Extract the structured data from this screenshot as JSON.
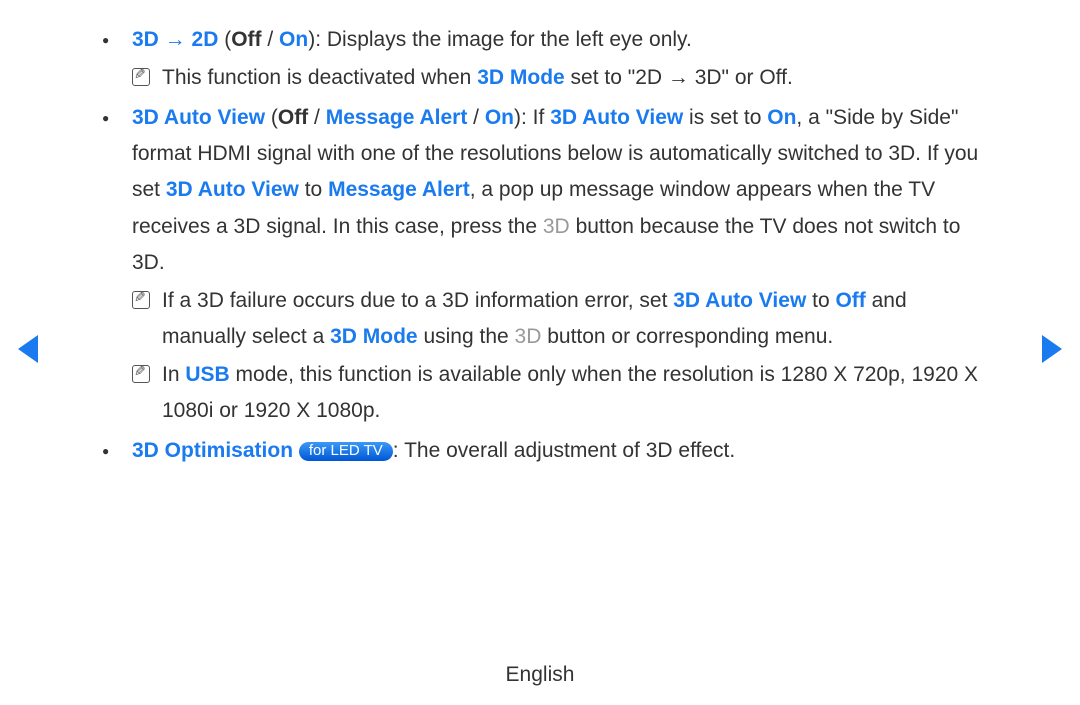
{
  "bullets": [
    {
      "title_pre": "3D → 2D",
      "paren_open": " (",
      "opt1": "Off",
      "sep1": " / ",
      "opt2": "On",
      "paren_close": "): ",
      "tail": "Displays the image for the left eye only.",
      "notes": [
        {
          "frag": [
            {
              "t": "This function is deactivated when "
            },
            {
              "t": "3D Mode",
              "cls": "bluebold"
            },
            {
              "t": " set to \"2D → 3D\" or Off."
            }
          ]
        }
      ]
    },
    {
      "frag_head": [
        {
          "t": "3D Auto View",
          "cls": "bluebold"
        },
        {
          "t": " ("
        },
        {
          "t": "Off",
          "cls": "bold"
        },
        {
          "t": " / "
        },
        {
          "t": "Message Alert",
          "cls": "bluebold"
        },
        {
          "t": " / "
        },
        {
          "t": "On",
          "cls": "bluebold"
        },
        {
          "t": "): If "
        },
        {
          "t": "3D Auto View",
          "cls": "bluebold"
        },
        {
          "t": " is set to "
        },
        {
          "t": "On",
          "cls": "bluebold"
        },
        {
          "t": ", a \"Side by Side\" format HDMI signal with one of the resolutions below is automatically switched to 3D. If you set "
        },
        {
          "t": "3D Auto View",
          "cls": "bluebold"
        },
        {
          "t": " to "
        },
        {
          "t": "Message Alert",
          "cls": "bluebold"
        },
        {
          "t": ", a pop up message window appears when the TV receives a 3D signal. In this case, press the "
        },
        {
          "t": "3D",
          "cls": "grey"
        },
        {
          "t": " button because the TV does not switch to 3D."
        }
      ],
      "notes": [
        {
          "frag": [
            {
              "t": "If a 3D failure occurs due to a 3D information error, set "
            },
            {
              "t": "3D Auto View",
              "cls": "bluebold"
            },
            {
              "t": " to "
            },
            {
              "t": "Off",
              "cls": "bluebold"
            },
            {
              "t": " and manually select a "
            },
            {
              "t": "3D Mode",
              "cls": "bluebold"
            },
            {
              "t": " using the "
            },
            {
              "t": "3D",
              "cls": "grey"
            },
            {
              "t": " button or corresponding menu."
            }
          ]
        },
        {
          "frag": [
            {
              "t": "In "
            },
            {
              "t": "USB",
              "cls": "bluebold"
            },
            {
              "t": " mode, this function is available only when the resolution is 1280 X 720p, 1920 X 1080i or 1920 X 1080p."
            }
          ]
        }
      ]
    },
    {
      "opt_title": "3D Optimisation",
      "badge": "for LED TV",
      "opt_tail": ": The overall adjustment of 3D effect."
    }
  ],
  "footer": "English"
}
